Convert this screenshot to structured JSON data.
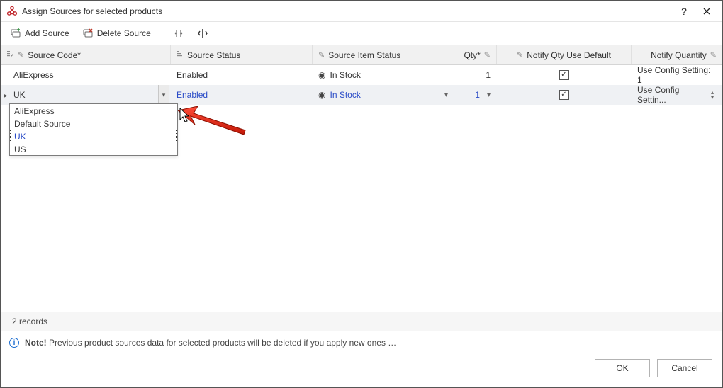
{
  "window": {
    "title": "Assign Sources for selected products"
  },
  "toolbar": {
    "add_source": "Add Source",
    "delete_source": "Delete Source"
  },
  "columns": {
    "source_code": "Source Code*",
    "source_status": "Source Status",
    "source_item_status": "Source Item Status",
    "qty": "Qty*",
    "notify_default": "Notify Qty Use Default",
    "notify_qty": "Notify Quantity"
  },
  "rows": [
    {
      "source_code": "AliExpress",
      "source_status": "Enabled",
      "item_status": "In Stock",
      "qty": "1",
      "notify_default_checked": true,
      "notify_qty_display": "Use Config Setting: 1"
    },
    {
      "source_code": "UK",
      "source_status": "Enabled",
      "item_status": "In Stock",
      "qty": "1",
      "notify_default_checked": true,
      "notify_qty_display": "Use Config Settin..."
    }
  ],
  "dropdown": {
    "options": [
      {
        "label": "AliExpress"
      },
      {
        "label": "Default Source"
      },
      {
        "label": "UK",
        "focused": true
      },
      {
        "label": "US"
      }
    ]
  },
  "status": {
    "records": "2 records"
  },
  "note": {
    "prefix": "Note!",
    "text": "Previous product sources data for selected products will be deleted if you apply new ones …"
  },
  "buttons": {
    "ok": "OK",
    "cancel": "Cancel"
  }
}
